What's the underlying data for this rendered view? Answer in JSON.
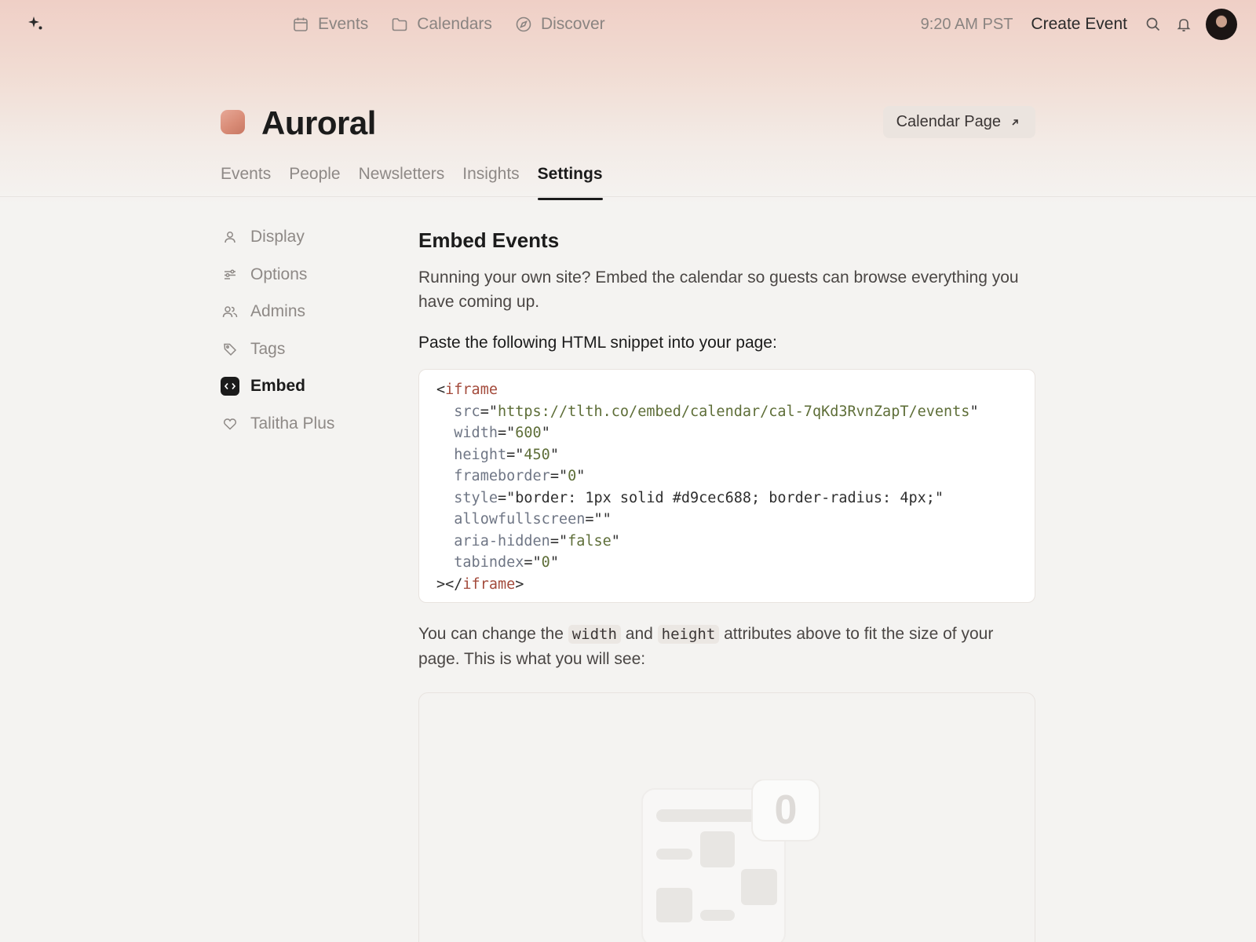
{
  "topnav": {
    "links": [
      {
        "label": "Events",
        "icon": "calendar-icon"
      },
      {
        "label": "Calendars",
        "icon": "folder-icon"
      },
      {
        "label": "Discover",
        "icon": "compass-icon"
      }
    ],
    "time": "9:20 AM PST",
    "create_label": "Create Event"
  },
  "header": {
    "title": "Auroral",
    "calendar_page_label": "Calendar Page"
  },
  "tabs": [
    "Events",
    "People",
    "Newsletters",
    "Insights",
    "Settings"
  ],
  "active_tab": "Settings",
  "side": {
    "items": [
      {
        "label": "Display",
        "icon": "person-icon"
      },
      {
        "label": "Options",
        "icon": "sliders-icon"
      },
      {
        "label": "Admins",
        "icon": "users-icon"
      },
      {
        "label": "Tags",
        "icon": "tag-icon"
      },
      {
        "label": "Embed",
        "icon": "code-icon"
      },
      {
        "label": "Talitha Plus",
        "icon": "heart-icon"
      }
    ],
    "active": "Embed"
  },
  "main": {
    "title": "Embed Events",
    "intro": "Running your own site? Embed the calendar so guests can browse everything you have coming up.",
    "instruction": "Paste the following HTML snippet into your page:",
    "snippet": {
      "open_tag": "iframe",
      "attrs": [
        {
          "name": "src",
          "value": "https://tlth.co/embed/calendar/cal-7qKd3RvnZapT/events"
        },
        {
          "name": "width",
          "value": "600"
        },
        {
          "name": "height",
          "value": "450"
        },
        {
          "name": "frameborder",
          "value": "0"
        },
        {
          "name": "style",
          "value": "border: 1px solid #d9cec688; border-radius: 4px;"
        },
        {
          "name": "allowfullscreen",
          "value": ""
        },
        {
          "name": "aria-hidden",
          "value": "false"
        },
        {
          "name": "tabindex",
          "value": "0"
        }
      ],
      "close_tag": "iframe"
    },
    "after_pre": "You can change the ",
    "after_code1": "width",
    "after_mid": " and ",
    "after_code2": "height",
    "after_post": " attributes above to fit the size of your page. This is what you will see:",
    "preview_count": "0"
  },
  "colors": {
    "accent_dark": "#1b1b1b",
    "brand_gradient_top": "#efcfc6",
    "code_tag": "#a34a3b",
    "code_string": "#5e6e38"
  }
}
